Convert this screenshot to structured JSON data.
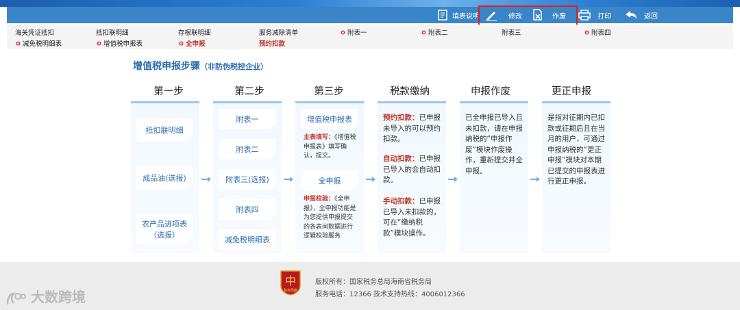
{
  "toolbar": {
    "fill_help": "填表说明",
    "modify": "修改",
    "void": "作废",
    "print": "打印",
    "back": "返回"
  },
  "links": {
    "row1": [
      "海关凭证抵扣",
      "抵扣联明细",
      "存根联明细",
      "服务减除清单",
      "附表一",
      "附表二",
      "附表三",
      "附表四"
    ],
    "row2": [
      "减免税明细表",
      "增值税申报表",
      "全申报",
      "预约扣款"
    ]
  },
  "heading": {
    "title": "增值税申报步骤",
    "subtitle": "（非防伪税控企业）"
  },
  "steps": [
    "第一步",
    "第二步",
    "第三步",
    "税款缴纳",
    "申报作废",
    "更正申报"
  ],
  "step1": [
    "抵扣联明细",
    "成品油(选报)",
    "农产品进项表",
    "（选报）"
  ],
  "step2": [
    "附表一",
    "附表二",
    "附表三(选报)",
    "附表四",
    "减免税明细表"
  ],
  "step3": {
    "card1": "增值税申报表",
    "note1_label": "主表填写：",
    "note1_text": "《增值税申报表》填写确认，提交。",
    "card2": "全申报",
    "note2_label": "申报校验：",
    "note2_text": "《全申报》，全申报功能是为您提供申报提交的各表间数据进行逻辑校验服务"
  },
  "payment": {
    "p1_label": "预约扣款：",
    "p1_text": "已申报未导入的可以预约扣款。",
    "p2_label": "自动扣款：",
    "p2_text": "已申报已导入的会自动扣款。",
    "p3_label": "手动扣款：",
    "p3_text": "已申报已导入未扣款的，可在“缴纳税款”模块操作。"
  },
  "void_text": "已全申报已导入且未扣款，请在申报纳税的“申报作废”模块作废操作，重新提交并全申报。",
  "correct_text": "是指对征期内已扣款或征期后且在当月的用户，可通过申报纳税的“更正申报”模块对本期已提交的申报表进行更正申报。",
  "footer": {
    "logo_text": "税务局徽",
    "copyright": "版权所有：国家税务总局海南省税务局",
    "service": "服务电话：12366 技术支持热线：4006012366"
  },
  "watermark": "大数跨境",
  "colors": {
    "toolbar": "#3a84c8",
    "accent": "#2b6cb0",
    "red": "#c0392b",
    "highlight_box": "#e02020"
  }
}
